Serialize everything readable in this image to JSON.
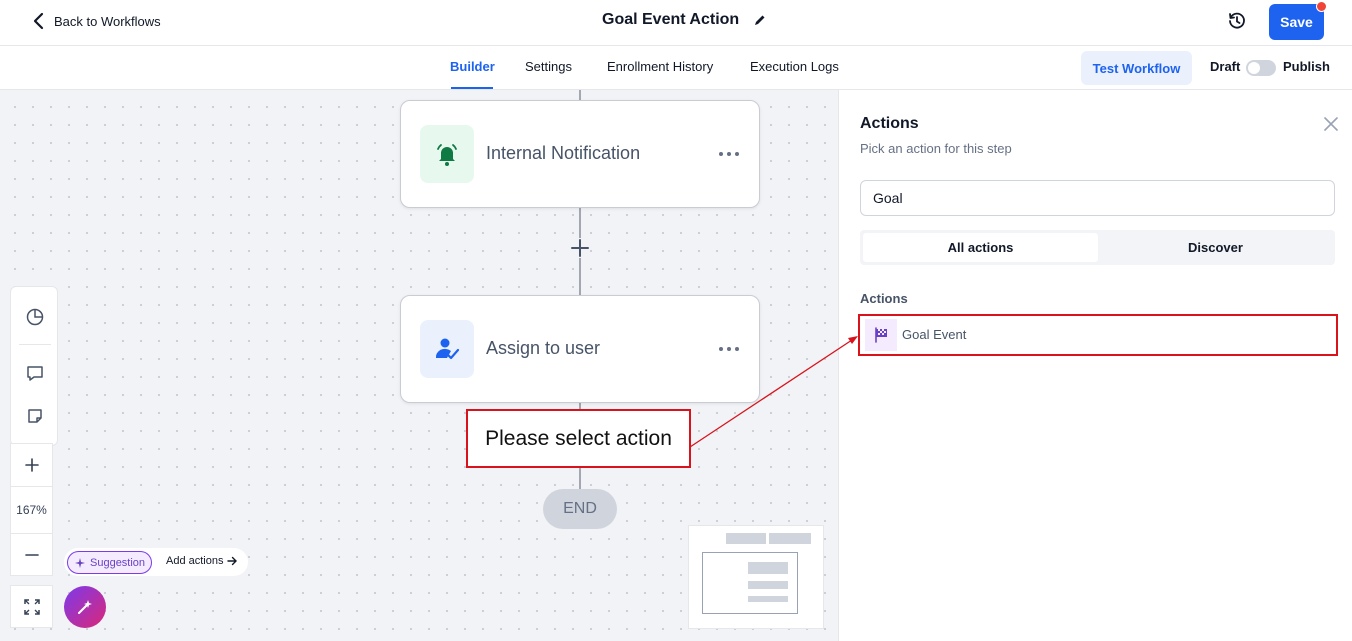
{
  "header": {
    "back_label": "Back to Workflows",
    "title": "Goal Event Action",
    "save_label": "Save"
  },
  "tabs": [
    {
      "label": "Builder",
      "active": true
    },
    {
      "label": "Settings",
      "active": false
    },
    {
      "label": "Enrollment History",
      "active": false
    },
    {
      "label": "Execution Logs",
      "active": false
    }
  ],
  "toolbar": {
    "test_label": "Test Workflow",
    "draft_label": "Draft",
    "publish_label": "Publish",
    "published": false
  },
  "canvas": {
    "nodes": [
      {
        "label": "Internal Notification",
        "icon": "bell-icon",
        "icon_bg": "#e7f8ef",
        "icon_color": "#0f7a43"
      },
      {
        "label": "Assign to user",
        "icon": "user-check-icon",
        "icon_bg": "#eaf1fd",
        "icon_color": "#1e63f0"
      }
    ],
    "callout": "Please select action",
    "end_label": "END",
    "zoom": "167%",
    "suggestion_label": "Suggestion",
    "add_actions_label": "Add actions"
  },
  "panel": {
    "title": "Actions",
    "subtitle": "Pick an action for this step",
    "search_value": "Goal",
    "segments": [
      {
        "label": "All actions",
        "active": true
      },
      {
        "label": "Discover",
        "active": false
      }
    ],
    "section_label": "Actions",
    "items": [
      {
        "label": "Goal Event",
        "icon": "flag-icon"
      }
    ]
  },
  "colors": {
    "accent": "#1e63f0",
    "highlight": "#d9121b",
    "ai_gradient_start": "#7c3aed",
    "ai_gradient_end": "#db2777"
  }
}
